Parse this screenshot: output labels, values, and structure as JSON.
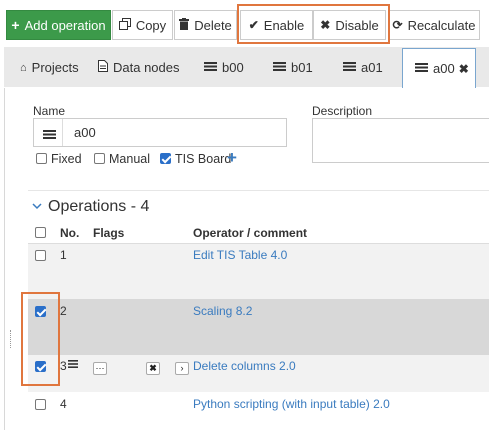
{
  "toolbar": {
    "add_operation": "Add operation",
    "copy": "Copy",
    "delete": "Delete",
    "enable": "Enable",
    "disable": "Disable",
    "recalculate": "Recalculate"
  },
  "tabs": [
    {
      "label": "Projects",
      "icon": "home-icon"
    },
    {
      "label": "Data nodes",
      "icon": "file-icon"
    },
    {
      "label": "b00",
      "icon": "table-icon"
    },
    {
      "label": "b01",
      "icon": "table-icon"
    },
    {
      "label": "a01",
      "icon": "table-icon"
    },
    {
      "label": "a00",
      "icon": "table-icon",
      "active": true
    }
  ],
  "form": {
    "name_label": "Name",
    "name_value": "a00",
    "description_label": "Description",
    "fixed_label": "Fixed",
    "manual_label": "Manual",
    "tis_board_label": "TIS Board",
    "fixed_checked": false,
    "manual_checked": false,
    "tis_board_checked": true
  },
  "operations": {
    "title": "Operations - 4",
    "headers": {
      "no": "No.",
      "flags": "Flags",
      "operator": "Operator / comment"
    },
    "rows": [
      {
        "no": "1",
        "operator": "Edit TIS Table 4.0",
        "checked": false
      },
      {
        "no": "2",
        "operator": "Scaling 8.2",
        "checked": true
      },
      {
        "no": "3",
        "operator": "Delete columns 2.0",
        "checked": true
      },
      {
        "no": "4",
        "operator": "Python scripting (with input table) 2.0",
        "checked": false
      }
    ]
  },
  "colors": {
    "primary_green": "#3c9a4a",
    "highlight_orange": "#e0763e",
    "link_blue": "#3a7bbf",
    "selected_row": "#d8d8d8"
  }
}
